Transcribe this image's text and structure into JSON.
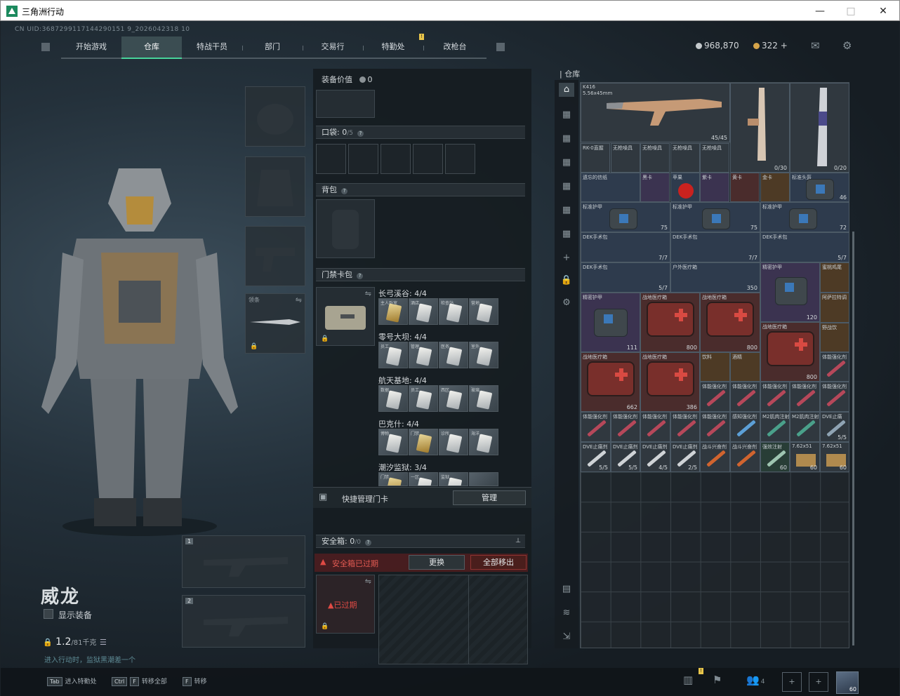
{
  "window": {
    "title": "三角洲行动",
    "minimize": "—",
    "maximize": "□",
    "close": "✕"
  },
  "uid": "CN UID:3687299117144290151 9_2026042318 10",
  "nav": {
    "tabs": [
      {
        "label": "开始游戏"
      },
      {
        "label": "仓库"
      },
      {
        "label": "特战干员"
      },
      {
        "label": "部门"
      },
      {
        "label": "交易行"
      },
      {
        "label": "特勤处"
      },
      {
        "label": "改枪台"
      }
    ],
    "active": "仓库",
    "alert_badge": "!"
  },
  "currency": {
    "hafcoin": "968,870",
    "premium": "322",
    "plus": "+"
  },
  "operator": {
    "name": "威龙",
    "show_equipment": "显示装备",
    "weight": "1.2",
    "weight_max": "/81千克",
    "hint": "进入行动时，监狱黑潮差一个"
  },
  "equip_slots": {
    "melee_label": "领条"
  },
  "weapon_slot_numbers": [
    "1",
    "2"
  ],
  "middle": {
    "equipment_value_label": "装备价值",
    "equipment_value": "0",
    "pocket_label": "口袋:",
    "pocket_count": "0",
    "pocket_max": "/5",
    "backpack_label": "背包",
    "keycard_label": "门禁卡包",
    "key_maps": [
      {
        "name": "长弓溪谷: 4/4",
        "cards": [
          "主人卧室",
          "酒店",
          "检查站",
          "营地"
        ]
      },
      {
        "name": "零号大坝: 4/4",
        "cards": [
          "员工",
          "管理",
          "医务",
          "室外"
        ]
      },
      {
        "name": "航天基地: 4/4",
        "cards": [
          "数据",
          "员工",
          "西区",
          "玻璃"
        ]
      },
      {
        "name": "巴克什: 4/4",
        "cards": [
          "博物",
          "门禁",
          "诊所",
          "海洋"
        ]
      },
      {
        "name": "潮汐监狱: 3/4",
        "cards": [
          "门禁",
          "一区",
          "监狱",
          ""
        ]
      }
    ],
    "quick_manage_label": "快捷管理门卡",
    "manage_button": "管理",
    "safebox_label": "安全箱:",
    "safebox_count": "0",
    "safebox_max": "/0",
    "safebox_expired_label": "安全箱已过期",
    "replace_button": "更换",
    "move_all_button": "全部移出",
    "expired_tag": "已过期",
    "pin": "📌"
  },
  "warehouse": {
    "title": "仓库",
    "items": [
      {
        "name": "K416",
        "sub": "5.56x45mm",
        "count": "45/45",
        "tone": "c-grey"
      },
      {
        "name": "",
        "sub": "",
        "count": "0/30",
        "tone": "c-grey"
      },
      {
        "name": "",
        "sub": "",
        "count": "0/20",
        "tone": "c-grey"
      },
      {
        "name": "RK-0直握",
        "count": "",
        "tone": "c-grey"
      },
      {
        "name": "无枪噪具",
        "count": "",
        "tone": "c-grey"
      },
      {
        "name": "无枪噪具",
        "count": "",
        "tone": "c-grey"
      },
      {
        "name": "无枪噪具",
        "count": "",
        "tone": "c-grey"
      },
      {
        "name": "无枪噪具",
        "count": "",
        "tone": "c-grey"
      },
      {
        "name": "遗忘的信纸",
        "count": "",
        "tone": "c-blue"
      },
      {
        "name": "黑卡",
        "count": "",
        "tone": "c-purple"
      },
      {
        "name": "苹果",
        "count": "",
        "tone": "c-blue"
      },
      {
        "name": "紫卡",
        "count": "",
        "tone": "c-purple"
      },
      {
        "name": "黄卡",
        "count": "",
        "tone": "c-red"
      },
      {
        "name": "金卡",
        "count": "",
        "tone": "c-gold"
      },
      {
        "name": "标准头盔",
        "count": "46",
        "tone": "c-blue"
      },
      {
        "name": "标准护甲",
        "count": "75",
        "tone": "c-blue"
      },
      {
        "name": "标准护甲",
        "count": "75",
        "tone": "c-blue"
      },
      {
        "name": "标准护甲",
        "count": "72",
        "tone": "c-blue"
      },
      {
        "name": "DEK手术包",
        "count": "7/7",
        "tone": "c-blue"
      },
      {
        "name": "DEK手术包",
        "count": "7/7",
        "tone": "c-blue"
      },
      {
        "name": "DEK手术包",
        "count": "5/7",
        "tone": "c-blue"
      },
      {
        "name": "DEK手术包",
        "count": "5/7",
        "tone": "c-blue"
      },
      {
        "name": "户外医疗箱",
        "count": "350",
        "tone": "c-blue"
      },
      {
        "name": "精密护甲",
        "count": "120",
        "tone": "c-purple"
      },
      {
        "name": "蜜桃鸡尾",
        "count": "",
        "tone": "c-gold"
      },
      {
        "name": "精密护甲",
        "count": "111",
        "tone": "c-purple"
      },
      {
        "name": "战地医疗箱",
        "count": "800",
        "tone": "c-red"
      },
      {
        "name": "战地医疗箱",
        "count": "800",
        "tone": "c-red"
      },
      {
        "name": "阿萨拉特调",
        "count": "",
        "tone": "c-gold"
      },
      {
        "name": "战地医疗箱",
        "count": "800",
        "tone": "c-red"
      },
      {
        "name": "野战饮",
        "count": "",
        "tone": "c-gold"
      },
      {
        "name": "战地医疗箱",
        "count": "662",
        "tone": "c-red"
      },
      {
        "name": "战地医疗箱",
        "count": "386",
        "tone": "c-red"
      },
      {
        "name": "饮料",
        "count": "",
        "tone": "c-gold"
      },
      {
        "name": "酒精",
        "count": "",
        "tone": "c-gold"
      },
      {
        "name": "体能强化剂",
        "count": "",
        "tone": "c-grey"
      },
      {
        "name": "体能强化剂",
        "count": "",
        "tone": "c-grey"
      },
      {
        "name": "体能强化剂",
        "count": "",
        "tone": "c-grey"
      },
      {
        "name": "体能强化剂",
        "count": "",
        "tone": "c-grey"
      },
      {
        "name": "体能强化剂",
        "count": "",
        "tone": "c-grey"
      },
      {
        "name": "体能强化剂",
        "count": "",
        "tone": "c-grey"
      },
      {
        "name": "体能强化剂",
        "count": "",
        "tone": "c-grey"
      },
      {
        "name": "体能强化剂",
        "count": "",
        "tone": "c-grey"
      },
      {
        "name": "体能强化剂",
        "count": "",
        "tone": "c-grey"
      },
      {
        "name": "体能强化剂",
        "count": "",
        "tone": "c-grey"
      },
      {
        "name": "体能强化剂",
        "count": "",
        "tone": "c-grey"
      },
      {
        "name": "感知强化剂",
        "count": "",
        "tone": "c-grey"
      },
      {
        "name": "M2肌肉注射",
        "count": "",
        "tone": "c-grey"
      },
      {
        "name": "M2肌肉注射",
        "count": "",
        "tone": "c-grey"
      },
      {
        "name": "DVE止痛",
        "count": "5/5",
        "tone": "c-grey"
      },
      {
        "name": "DVE止痛剂",
        "count": "5/5",
        "tone": "c-grey"
      },
      {
        "name": "DVE止痛剂",
        "count": "5/5",
        "tone": "c-grey"
      },
      {
        "name": "DVE止痛剂",
        "count": "4/5",
        "tone": "c-grey"
      },
      {
        "name": "DVE止痛剂",
        "count": "2/5",
        "tone": "c-grey"
      },
      {
        "name": "战斗兴奋剂",
        "count": "",
        "tone": "c-grey"
      },
      {
        "name": "战斗兴奋剂",
        "count": "",
        "tone": "c-grey"
      },
      {
        "name": "强效注射",
        "count": "60",
        "tone": "c-green"
      },
      {
        "name": "7.62x51",
        "count": "60",
        "tone": "c-grey"
      },
      {
        "name": "7.62x51",
        "count": "60",
        "tone": "c-grey"
      }
    ]
  },
  "bottom": {
    "enter_key": "Tab",
    "enter_label": "进入特勤处",
    "transfer_all_key1": "Ctrl",
    "transfer_all_key2": "F",
    "transfer_all_label": "转移全部",
    "transfer_key": "F",
    "transfer_label": "转移",
    "friends_count": "4",
    "avatar_level": "60"
  }
}
